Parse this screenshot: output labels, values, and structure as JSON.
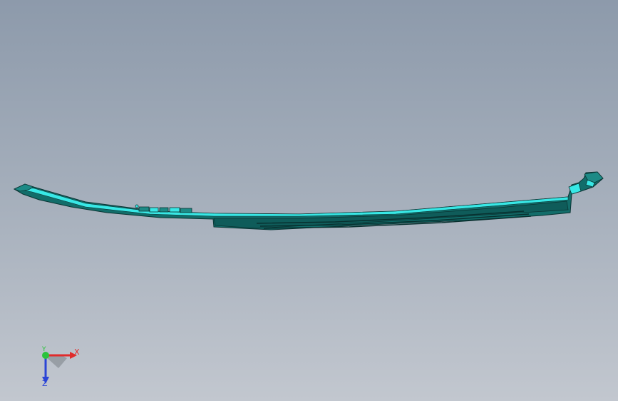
{
  "triad": {
    "x_label": "X",
    "y_label": "Y",
    "z_label": "Z"
  },
  "colors": {
    "background_top": "#8d9aab",
    "background_bottom": "#c2c7cf",
    "part_dark": "#126d6a",
    "part_mid": "#1d8a86",
    "part_highlight": "#38e8e6",
    "edge": "#0a3433",
    "axis_x": "#e02b2b",
    "axis_y": "#2bc33b",
    "axis_z": "#2b45d6"
  }
}
